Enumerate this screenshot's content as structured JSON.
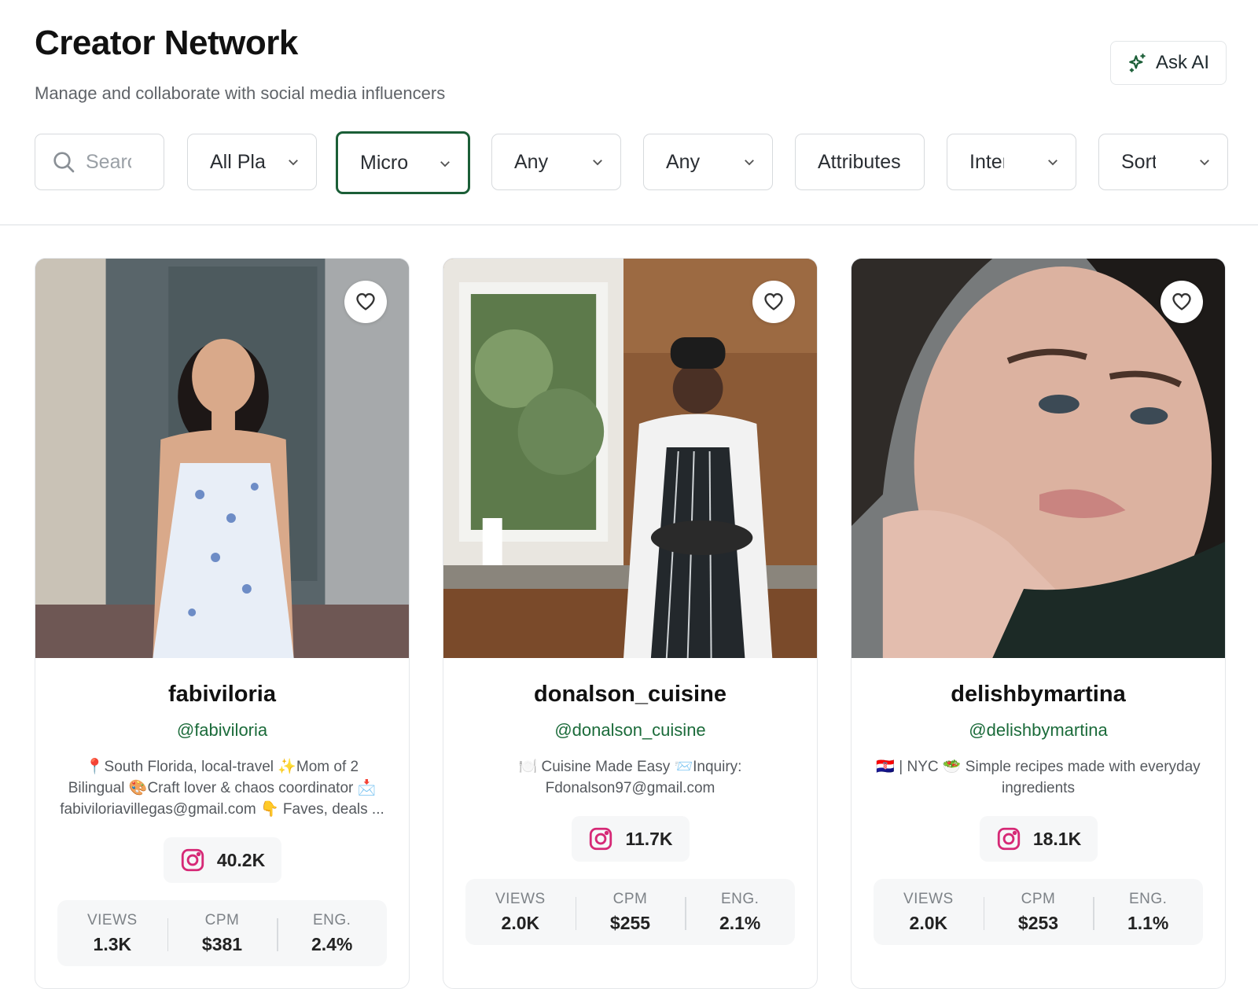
{
  "header": {
    "title": "Creator Network",
    "subtitle": "Manage and collaborate with social media influencers"
  },
  "ask_ai": {
    "label": "Ask AI",
    "icon": "sparkle-icon"
  },
  "filters": {
    "search_placeholder": "Searcl",
    "platform": "All Pla",
    "tier": "Micro",
    "views": "Any Vi",
    "rate": "Any Ra",
    "attributes": "Attributes",
    "interests": "Interes",
    "sort": "Sort: D"
  },
  "creators": [
    {
      "name": "fabiviloria",
      "handle": "@fabiviloria",
      "bio": "📍South Florida, local-travel ✨Mom of 2 Bilingual 🎨Craft lover & chaos coordinator 📩 fabiviloriavillegas@gmail.com 👇 Faves, deals ...",
      "platform": "instagram",
      "followers": "40.2K",
      "views_label": "VIEWS",
      "views": "1.3K",
      "cpm_label": "CPM",
      "cpm": "$381",
      "eng_label": "ENG.",
      "eng": "2.4%"
    },
    {
      "name": "donalson_cuisine",
      "handle": "@donalson_cuisine",
      "bio": "🍽️ Cuisine Made Easy 📨Inquiry: Fdonalson97@gmail.com",
      "platform": "instagram",
      "followers": "11.7K",
      "views_label": "VIEWS",
      "views": "2.0K",
      "cpm_label": "CPM",
      "cpm": "$255",
      "eng_label": "ENG.",
      "eng": "2.1%"
    },
    {
      "name": "delishbymartina",
      "handle": "@delishbymartina",
      "bio": "🇭🇷 | NYC 🥗 Simple recipes made with everyday ingredients",
      "platform": "instagram",
      "followers": "18.1K",
      "views_label": "VIEWS",
      "views": "2.0K",
      "cpm_label": "CPM",
      "cpm": "$253",
      "eng_label": "ENG.",
      "eng": "1.1%"
    }
  ]
}
